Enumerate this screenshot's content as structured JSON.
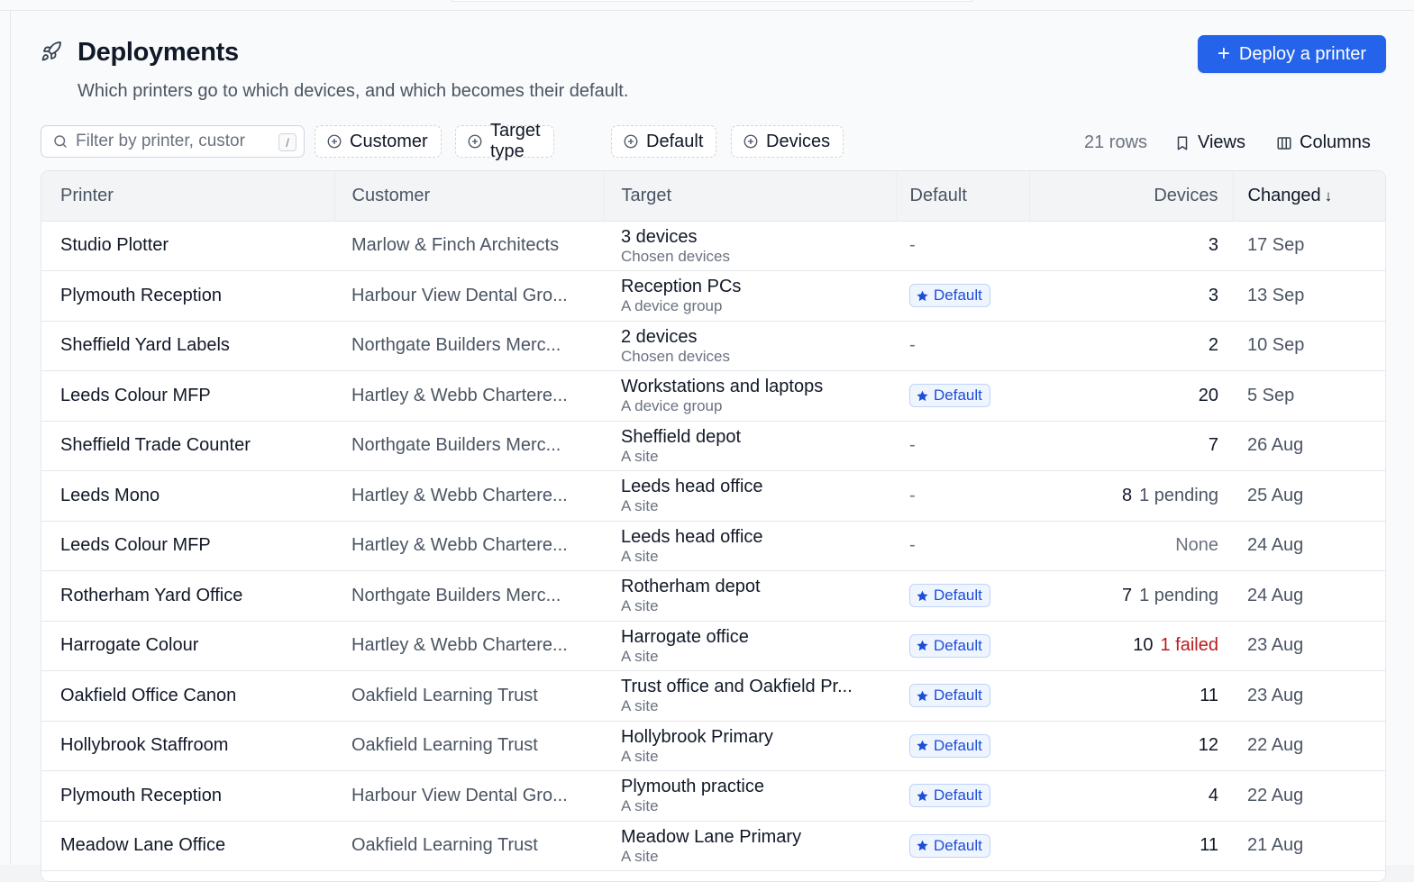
{
  "header": {
    "title": "Deployments",
    "subtitle": "Which printers go to which devices, and which becomes their default.",
    "deploy_button_label": "Deploy a printer",
    "icon": "rocket-icon"
  },
  "toolbar": {
    "search_placeholder": "Filter by printer, custor",
    "search_shortcut": "/",
    "filters": [
      "Customer",
      "Target type",
      "Default",
      "Devices"
    ],
    "row_count": "21 rows",
    "views_label": "Views",
    "columns_label": "Columns"
  },
  "table": {
    "columns": [
      "Printer",
      "Customer",
      "Target",
      "Default",
      "Devices",
      "Changed"
    ],
    "sort_column": "Changed",
    "default_badge_label": "Default",
    "rows": [
      {
        "printer": "Studio Plotter",
        "customer": "Marlow & Finch Architects",
        "target": "3 devices",
        "target_type": "Chosen devices",
        "default": "-",
        "devices": "3",
        "status": "",
        "changed": "17 Sep"
      },
      {
        "printer": "Plymouth Reception",
        "customer": "Harbour View Dental Gro...",
        "target": "Reception PCs",
        "target_type": "A device group",
        "default": "Default",
        "devices": "3",
        "status": "",
        "changed": "13 Sep"
      },
      {
        "printer": "Sheffield Yard Labels",
        "customer": "Northgate Builders Merc...",
        "target": "2 devices",
        "target_type": "Chosen devices",
        "default": "-",
        "devices": "2",
        "status": "",
        "changed": "10 Sep"
      },
      {
        "printer": "Leeds Colour MFP",
        "customer": "Hartley & Webb Chartere...",
        "target": "Workstations and laptops",
        "target_type": "A device group",
        "default": "Default",
        "devices": "20",
        "status": "",
        "changed": "5 Sep"
      },
      {
        "printer": "Sheffield Trade Counter",
        "customer": "Northgate Builders Merc...",
        "target": "Sheffield depot",
        "target_type": "A site",
        "default": "-",
        "devices": "7",
        "status": "",
        "changed": "26 Aug"
      },
      {
        "printer": "Leeds Mono",
        "customer": "Hartley & Webb Chartere...",
        "target": "Leeds head office",
        "target_type": "A site",
        "default": "-",
        "devices": "8",
        "status": "1 pending",
        "changed": "25 Aug"
      },
      {
        "printer": "Leeds Colour MFP",
        "customer": "Hartley & Webb Chartere...",
        "target": "Leeds head office",
        "target_type": "A site",
        "default": "-",
        "devices": "None",
        "status": "",
        "changed": "24 Aug"
      },
      {
        "printer": "Rotherham Yard Office",
        "customer": "Northgate Builders Merc...",
        "target": "Rotherham depot",
        "target_type": "A site",
        "default": "Default",
        "devices": "7",
        "status": "1 pending",
        "changed": "24 Aug"
      },
      {
        "printer": "Harrogate Colour",
        "customer": "Hartley & Webb Chartere...",
        "target": "Harrogate office",
        "target_type": "A site",
        "default": "Default",
        "devices": "10",
        "status": "1 failed",
        "changed": "23 Aug"
      },
      {
        "printer": "Oakfield Office Canon",
        "customer": "Oakfield Learning Trust",
        "target": "Trust office and Oakfield Pr...",
        "target_type": "A site",
        "default": "Default",
        "devices": "11",
        "status": "",
        "changed": "23 Aug"
      },
      {
        "printer": "Hollybrook Staffroom",
        "customer": "Oakfield Learning Trust",
        "target": "Hollybrook Primary",
        "target_type": "A site",
        "default": "Default",
        "devices": "12",
        "status": "",
        "changed": "22 Aug"
      },
      {
        "printer": "Plymouth Reception",
        "customer": "Harbour View Dental Gro...",
        "target": "Plymouth practice",
        "target_type": "A site",
        "default": "Default",
        "devices": "4",
        "status": "",
        "changed": "22 Aug"
      },
      {
        "printer": "Meadow Lane Office",
        "customer": "Oakfield Learning Trust",
        "target": "Meadow Lane Primary",
        "target_type": "A site",
        "default": "Default",
        "devices": "11",
        "status": "",
        "changed": "21 Aug"
      }
    ]
  },
  "colors": {
    "accent": "#2563eb",
    "badge_text": "#1d4ed8",
    "failed": "#b91c1c"
  }
}
